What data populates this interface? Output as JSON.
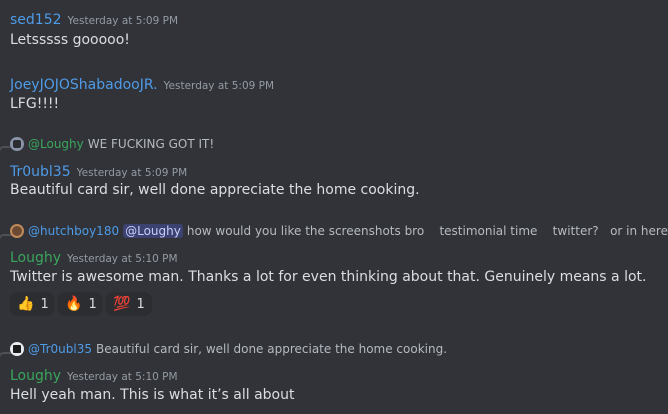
{
  "messages": [
    {
      "author": "sed152",
      "author_color": "#4e9be8",
      "timestamp": "Yesterday at 5:09 PM",
      "text": "Letsssss gooooo!"
    },
    {
      "author": "JoeyJOJOShabadooJR.",
      "author_color": "#4e9be8",
      "timestamp": "Yesterday at 5:09 PM",
      "text": "LFG!!!!"
    },
    {
      "reply": {
        "name": "@Loughy",
        "text": "WE FUCKING GOT IT!",
        "name_color": "#3ba55c"
      },
      "author": "Tr0ubl35",
      "author_color": "#4e9be8",
      "timestamp": "Yesterday at 5:09 PM",
      "text": "Beautiful card sir, well done appreciate the home cooking."
    },
    {
      "reply": {
        "name": "@hutchboy180",
        "mention": "@Loughy",
        "text": "how would you like the screenshots bro    testimonial time    twitter?   or in here",
        "name_color": "#4e9be8"
      },
      "author": "Loughy",
      "author_color": "#3ba55c",
      "timestamp": "Yesterday at 5:10 PM",
      "text": "Twitter is awesome man. Thanks a lot for even thinking about that. Genuinely means a lot.",
      "reactions": [
        {
          "emoji": "👍",
          "icon": "thumbs-up-icon",
          "count": "1"
        },
        {
          "emoji": "🔥",
          "icon": "fire-icon",
          "count": "1"
        },
        {
          "emoji": "💯",
          "icon": "hundred-points-icon",
          "count": "1"
        }
      ]
    },
    {
      "reply": {
        "name": "@Tr0ubl35",
        "text": "Beautiful card sir, well done appreciate the home cooking.",
        "name_color": "#4e9be8"
      },
      "author": "Loughy",
      "author_color": "#3ba55c",
      "timestamp": "Yesterday at 5:10 PM",
      "text": "Hell yeah man. This is what it’s all about"
    }
  ]
}
